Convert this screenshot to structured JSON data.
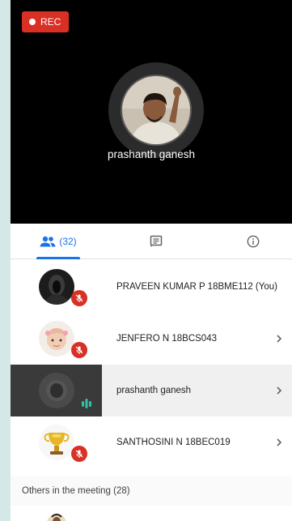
{
  "recording": {
    "label": "REC",
    "color": "#d93025"
  },
  "main_speaker": {
    "name": "prashanth ganesh"
  },
  "tabs": [
    {
      "id": "people",
      "icon": "people-icon",
      "count_label": "(32)",
      "selected": true
    },
    {
      "id": "chat",
      "icon": "chat-icon",
      "selected": false
    },
    {
      "id": "info",
      "icon": "info-icon",
      "selected": false
    }
  ],
  "participants": [
    {
      "name": "PRAVEEN KUMAR P 18BME112 (You)",
      "status": "muted",
      "chevron": false
    },
    {
      "name": "JENFERO N 18BCS043",
      "status": "muted",
      "chevron": true
    },
    {
      "name": "prashanth ganesh",
      "status": "speaking",
      "chevron": true,
      "active": true
    },
    {
      "name": "SANTHOSINI N 18BEC019",
      "status": "muted",
      "chevron": true
    }
  ],
  "others_section": {
    "label": "Others in the meeting (28)"
  },
  "colors": {
    "accent": "#1a73e8",
    "mute": "#d93025",
    "speaking": "#34c2a4"
  }
}
